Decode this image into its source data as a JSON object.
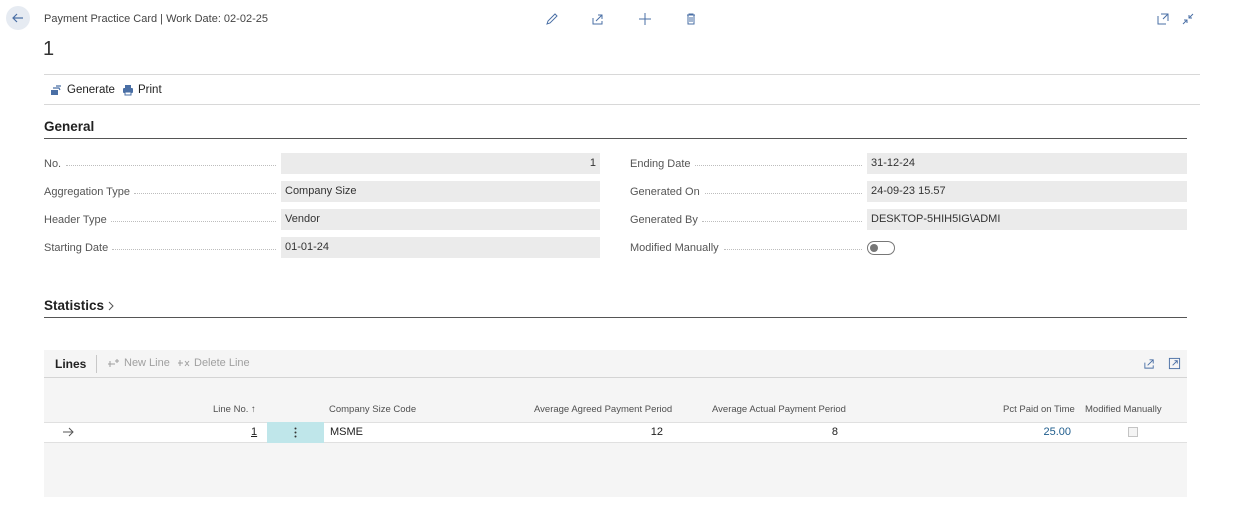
{
  "header": {
    "breadcrumb": "Payment Practice Card | Work Date: 02-02-25",
    "title": "1"
  },
  "actions": {
    "generate": "Generate",
    "print": "Print"
  },
  "general": {
    "title": "General",
    "fields": {
      "no": {
        "label": "No.",
        "value": "1"
      },
      "aggregation_type": {
        "label": "Aggregation Type",
        "value": "Company Size"
      },
      "header_type": {
        "label": "Header Type",
        "value": "Vendor"
      },
      "starting_date": {
        "label": "Starting Date",
        "value": "01-01-24"
      },
      "ending_date": {
        "label": "Ending Date",
        "value": "31-12-24"
      },
      "generated_on": {
        "label": "Generated On",
        "value": "24-09-23 15.57"
      },
      "generated_by": {
        "label": "Generated By",
        "value": "DESKTOP-5HIH5IG\\ADMI"
      },
      "modified_manually": {
        "label": "Modified Manually",
        "value": false
      }
    }
  },
  "statistics": {
    "title": "Statistics"
  },
  "lines": {
    "title": "Lines",
    "new_line": "New Line",
    "delete_line": "Delete Line",
    "columns": {
      "line_no": "Line No. ↑",
      "company_size_code": "Company Size Code",
      "avg_agreed": "Average Agreed Payment Period",
      "avg_actual": "Average Actual Payment Period",
      "pct_paid": "Pct Paid on Time",
      "modified_manually": "Modified Manually"
    },
    "rows": [
      {
        "line_no": "1",
        "company_size_code": "MSME",
        "avg_agreed": "12",
        "avg_actual": "8",
        "pct_paid": "25.00",
        "modified_manually": false
      }
    ]
  },
  "colors": {
    "accent": "#4a6fa5",
    "link": "#1e5c8c",
    "selected_cell": "#bfe6ea"
  }
}
